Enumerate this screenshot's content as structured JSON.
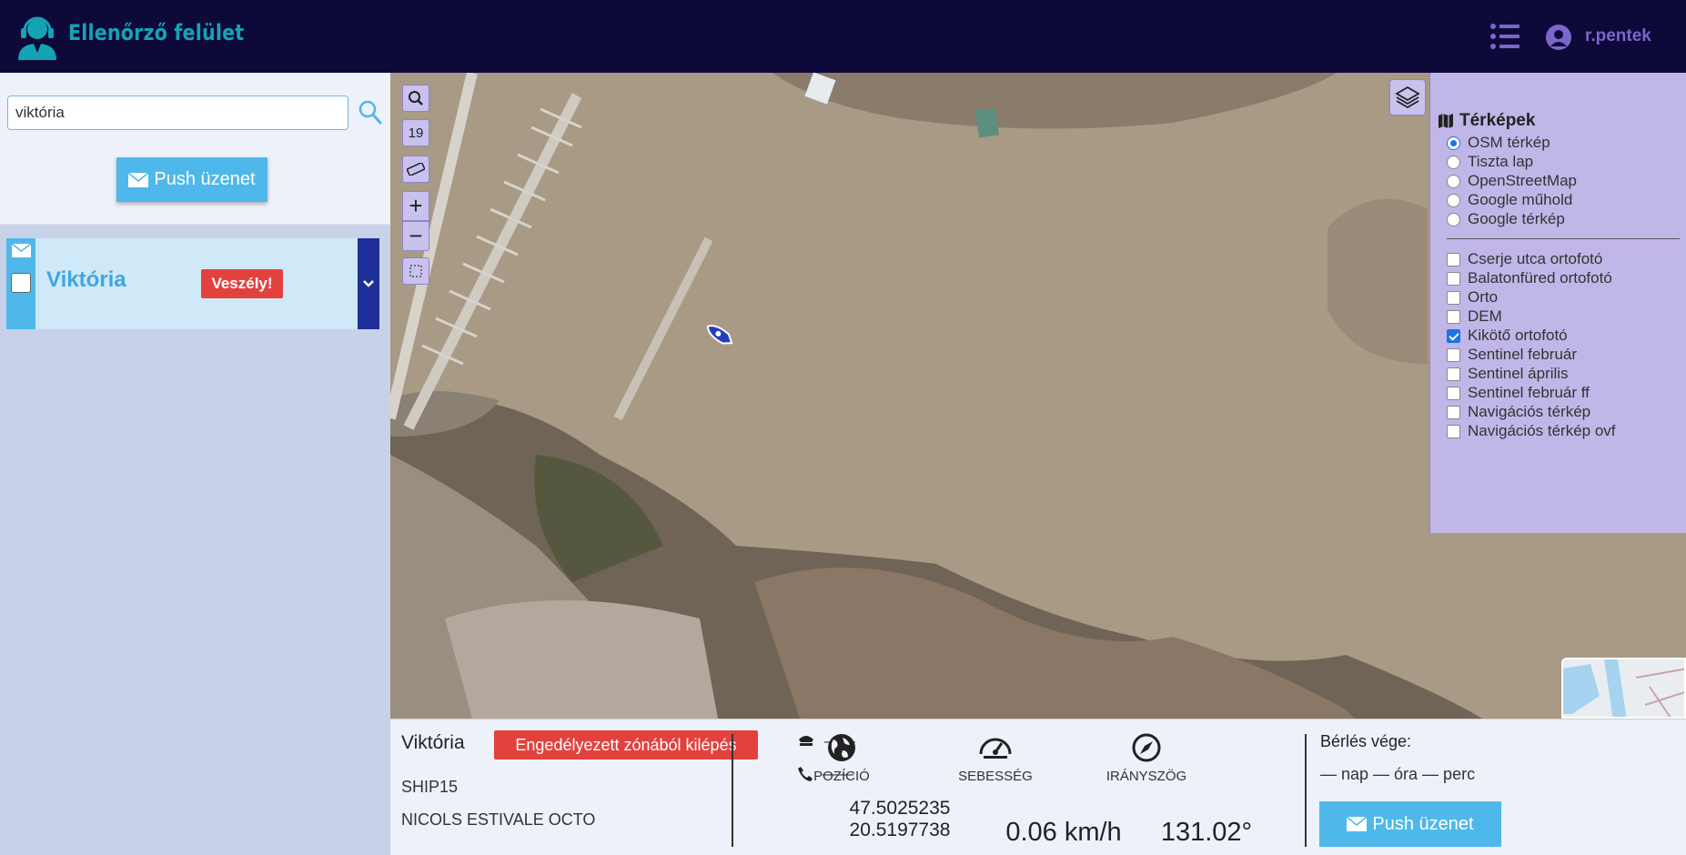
{
  "header": {
    "title": "Ellenőrző felület",
    "username": "r.pentek",
    "brand_icon": "operator-headset-icon",
    "menu_icon": "list-menu-icon",
    "user_icon": "user-circle-icon"
  },
  "sidebar": {
    "search": {
      "value": "viktória",
      "placeholder": ""
    },
    "push_button_label": "Push üzenet",
    "vessels": [
      {
        "name": "Viktória",
        "badge": "Veszély!",
        "checked": false
      }
    ]
  },
  "map": {
    "zoom_level": "19",
    "layers_panel": {
      "title": "Térképek",
      "base_layers": [
        {
          "label": "OSM térkép",
          "selected": true
        },
        {
          "label": "Tiszta lap",
          "selected": false
        },
        {
          "label": "OpenStreetMap",
          "selected": false
        },
        {
          "label": "Google műhold",
          "selected": false
        },
        {
          "label": "Google térkép",
          "selected": false
        }
      ],
      "overlays": [
        {
          "label": "Cserje utca ortofotó",
          "checked": false
        },
        {
          "label": "Balatonfüred ortofotó",
          "checked": false
        },
        {
          "label": "Orto",
          "checked": false
        },
        {
          "label": "DEM",
          "checked": false
        },
        {
          "label": "Kikötő ortofotó",
          "checked": true
        },
        {
          "label": "Sentinel február",
          "checked": false
        },
        {
          "label": "Sentinel április",
          "checked": false
        },
        {
          "label": "Sentinel február ff",
          "checked": false
        },
        {
          "label": "Navigációs térkép",
          "checked": false
        },
        {
          "label": "Navigációs térkép ovf",
          "checked": false
        }
      ]
    }
  },
  "details": {
    "vessel_name": "Viktória",
    "alert": "Engedélyezett zónából kilépés",
    "ship_id": "SHIP15",
    "model": "NICOLS ESTIVALE OCTO",
    "captain": "——",
    "phone": "——",
    "position_label": "POZÍCIÓ",
    "latitude": "47.5025235",
    "longitude": "20.5197738",
    "speed_label": "SEBESSÉG",
    "speed": "0.06 km/h",
    "heading_label": "IRÁNYSZÖG",
    "heading": "131.02°",
    "rent_end_label": "Bérlés vége:",
    "rent_end_value": "— nap — óra — perc",
    "push_button_label": "Push üzenet"
  },
  "colors": {
    "header_bg": "#0d0a3a",
    "brand": "#14a3b4",
    "accent": "#4fb8ea",
    "danger": "#e3413e",
    "panel": "#c9c2ee"
  }
}
